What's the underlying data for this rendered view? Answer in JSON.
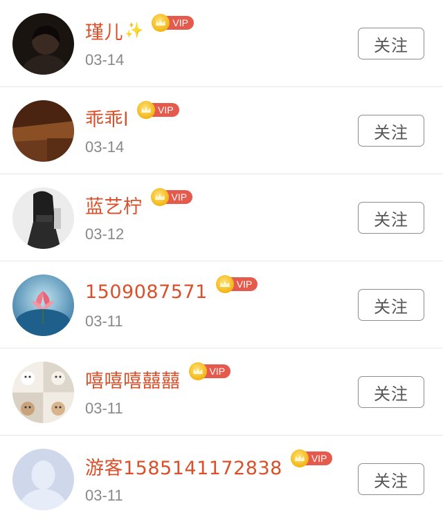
{
  "follow_list": {
    "items": [
      {
        "name": "瑾儿",
        "has_sparkle": true,
        "vip_label": "VIP",
        "date": "03-14",
        "follow_label": "关注"
      },
      {
        "name": "乖乖l",
        "has_sparkle": false,
        "vip_label": "VIP",
        "date": "03-14",
        "follow_label": "关注"
      },
      {
        "name": "蓝艺柠",
        "has_sparkle": false,
        "vip_label": "VIP",
        "date": "03-12",
        "follow_label": "关注"
      },
      {
        "name": "1509087571",
        "has_sparkle": false,
        "vip_label": "VIP",
        "date": "03-11",
        "follow_label": "关注"
      },
      {
        "name": "嘻嘻嘻囍囍",
        "has_sparkle": false,
        "vip_label": "VIP",
        "date": "03-11",
        "follow_label": "关注"
      },
      {
        "name": "游客1585141172838",
        "has_sparkle": false,
        "vip_label": "VIP",
        "date": "03-11",
        "follow_label": "关注"
      }
    ]
  },
  "colors": {
    "name": "#d9502a",
    "date": "#888888",
    "vip_badge": "#e45a4c",
    "crown": "#f3b512",
    "button_border": "#8c8c8c"
  }
}
